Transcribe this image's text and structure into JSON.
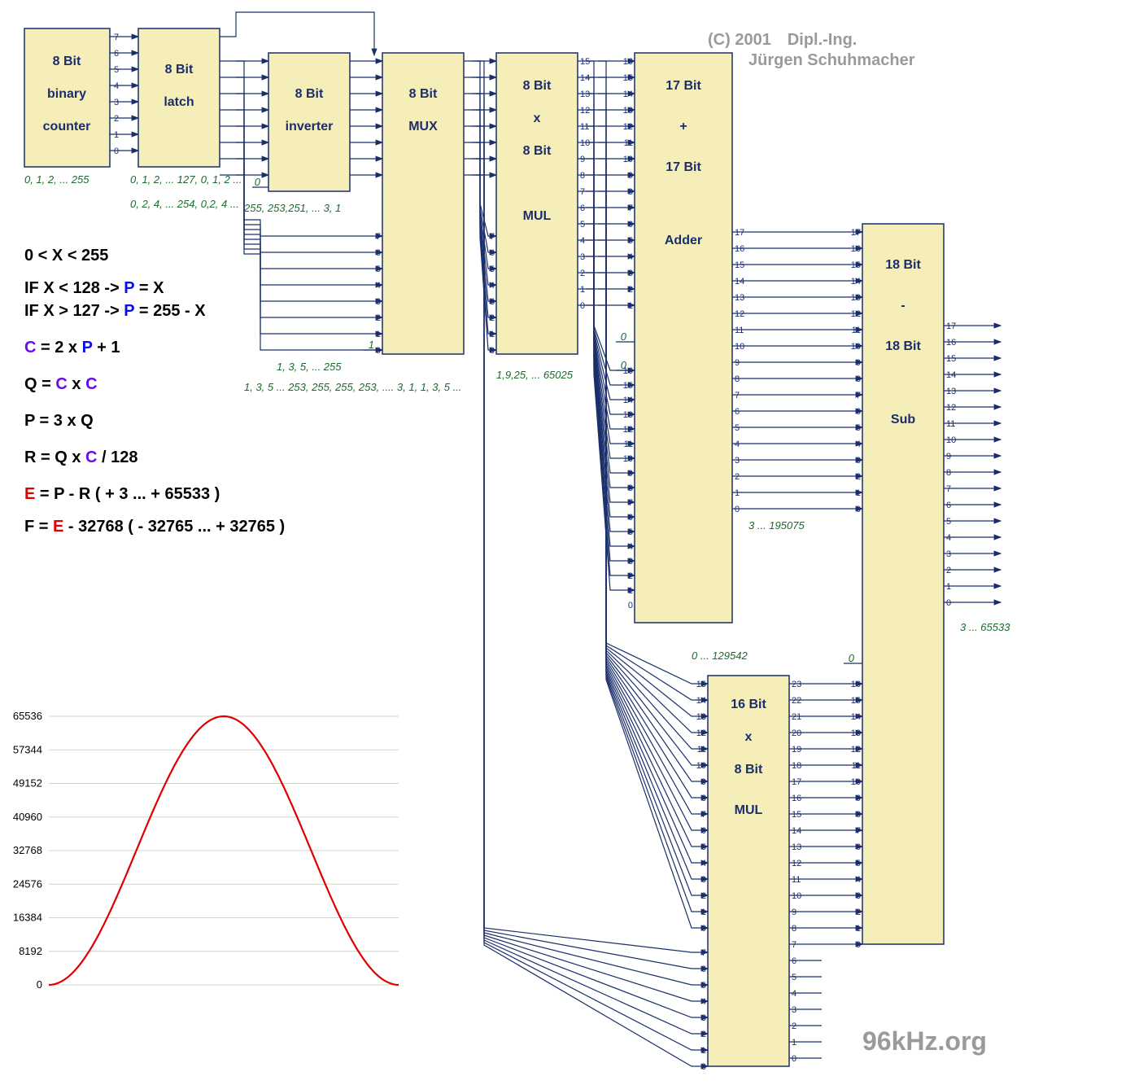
{
  "copyright": {
    "c": "(C) 2001",
    "t1": "Dipl.-Ing.",
    "t2": "Jürgen Schuhmacher"
  },
  "watermark": "96kHz.org",
  "blocks": {
    "counter": [
      "8 Bit",
      "binary",
      "counter"
    ],
    "latch": [
      "8 Bit",
      "latch"
    ],
    "inverter": [
      "8 Bit",
      "inverter"
    ],
    "mux": [
      "8 Bit",
      "MUX"
    ],
    "mul1": [
      "8 Bit",
      "x",
      "8 Bit",
      "MUL"
    ],
    "adder": [
      "17 Bit",
      "+",
      "17 Bit",
      "Adder"
    ],
    "mul2": [
      "16 Bit",
      "x",
      "8 Bit",
      "MUL"
    ],
    "sub": [
      "18 Bit",
      "-",
      "18 Bit",
      "Sub"
    ]
  },
  "seq": {
    "counter": "0, 1, 2, ... 255",
    "latch1": "0, 1, 2, ... 127, 0, 1, 2 ...",
    "latch2": "0, 2, 4, ... 254, 0,2, 4 ...",
    "inv": "255, 253,251, ... 3, 1",
    "muxA": "1, 3, 5, ... 255",
    "muxB": "1, 3, 5 ... 253, 255, 255, 253, .... 3, 1, 1, 3, 5 ...",
    "mul1": "1,9,25, ... 65025",
    "adder": "3 ... 195075",
    "mul2": "0 ... 129542",
    "sub": "3 ... 65533"
  },
  "equations": [
    {
      "parts": [
        {
          "t": "0 < X < 255"
        }
      ]
    },
    {
      "parts": [
        {
          "t": "IF  X < 128  -> "
        },
        {
          "t": "P",
          "c": "eqP"
        },
        {
          "t": " = X"
        }
      ]
    },
    {
      "parts": [
        {
          "t": "IF  X > 127  -> "
        },
        {
          "t": "P",
          "c": "eqP"
        },
        {
          "t": " = 255 - X"
        }
      ]
    },
    {
      "parts": [
        {
          "t": "C",
          "c": "eqC"
        },
        {
          "t": " = 2 x "
        },
        {
          "t": "P",
          "c": "eqP"
        },
        {
          "t": "  +  1"
        }
      ]
    },
    {
      "parts": [
        {
          "t": "Q = "
        },
        {
          "t": "C",
          "c": "eqC"
        },
        {
          "t": " x "
        },
        {
          "t": "C",
          "c": "eqC"
        }
      ]
    },
    {
      "parts": [
        {
          "t": "P = 3 x Q"
        }
      ]
    },
    {
      "parts": [
        {
          "t": "R = Q x "
        },
        {
          "t": "C",
          "c": "eqC"
        },
        {
          "t": "  /  128"
        }
      ]
    },
    {
      "parts": [
        {
          "t": "E",
          "c": "eqE"
        },
        {
          "t": " = P - R          (      + 3 ... + 65533 )"
        }
      ]
    },
    {
      "parts": [
        {
          "t": "F = "
        },
        {
          "t": "E",
          "c": "eqE"
        },
        {
          "t": " - 32768   ( - 32765 ...  + 32765 )"
        }
      ]
    }
  ],
  "chart_data": {
    "type": "line",
    "title": "",
    "xlabel": "",
    "ylabel": "",
    "ylim": [
      0,
      65536
    ],
    "yticks": [
      0,
      8192,
      16384,
      24576,
      32768,
      40960,
      49152,
      57344,
      65536
    ],
    "x_range": [
      0,
      255
    ],
    "function": "65536*sin(pi*x/255)^2 approximated",
    "x": [
      0,
      16,
      32,
      48,
      64,
      80,
      96,
      112,
      128,
      144,
      160,
      176,
      192,
      208,
      224,
      240,
      255
    ],
    "y": [
      0,
      2500,
      9600,
      20000,
      32768,
      45500,
      56000,
      63000,
      65536,
      63000,
      56000,
      45500,
      32768,
      20000,
      9600,
      2500,
      0
    ]
  },
  "const": {
    "zero": "0",
    "one": "1"
  }
}
